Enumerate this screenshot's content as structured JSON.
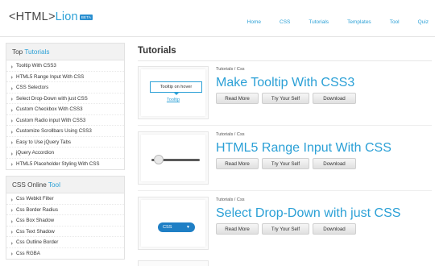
{
  "logo": {
    "prefix": "<HTML>",
    "suffix": "Lion",
    "badge": "BETA"
  },
  "nav": [
    "Home",
    "CSS",
    "Tutorials",
    "Templates",
    "Tool",
    "Quiz"
  ],
  "sidebar": {
    "tutorials": {
      "title_prefix": "Top ",
      "title_accent": "Tutorials",
      "items": [
        "Tooltip With CSS3",
        "HTML5 Range Input With CSS",
        "CSS Selectors",
        "Select Drop-Down with just CSS",
        "Custom Checkbox With CSS3",
        "Custom Radio input With CSS3",
        "Customize Scrollbars Using CSS3",
        "Easy to Use jQuery Tabs",
        "jQuery Accordion",
        "HTML5 Placeholder Styling With CSS"
      ]
    },
    "tools": {
      "title_prefix": "CSS Online ",
      "title_accent": "Tool",
      "items": [
        "Css Webkit Filter",
        "Css Border Radius",
        "Css Box Shadow",
        "Css Text Shadow",
        "Css Outline Border",
        "Css RGBA"
      ]
    }
  },
  "main": {
    "title": "Tutorials",
    "buttons": {
      "read": "Read More",
      "try": "Try Your Self",
      "download": "Download"
    },
    "cards": [
      {
        "crumb": "Tutorials / Css",
        "title": "Make Tooltip With CSS3",
        "preview_tooltip": "Tooltip on hover",
        "preview_link": "Tooltip"
      },
      {
        "crumb": "Tutorials / Css",
        "title": "HTML5 Range Input With CSS"
      },
      {
        "crumb": "Tutorials / Css",
        "title": "Select Drop-Down with just CSS",
        "preview_select": "CSS"
      }
    ]
  },
  "colors": {
    "accent": "#2ba0d6",
    "select": "#1f7fc5"
  }
}
